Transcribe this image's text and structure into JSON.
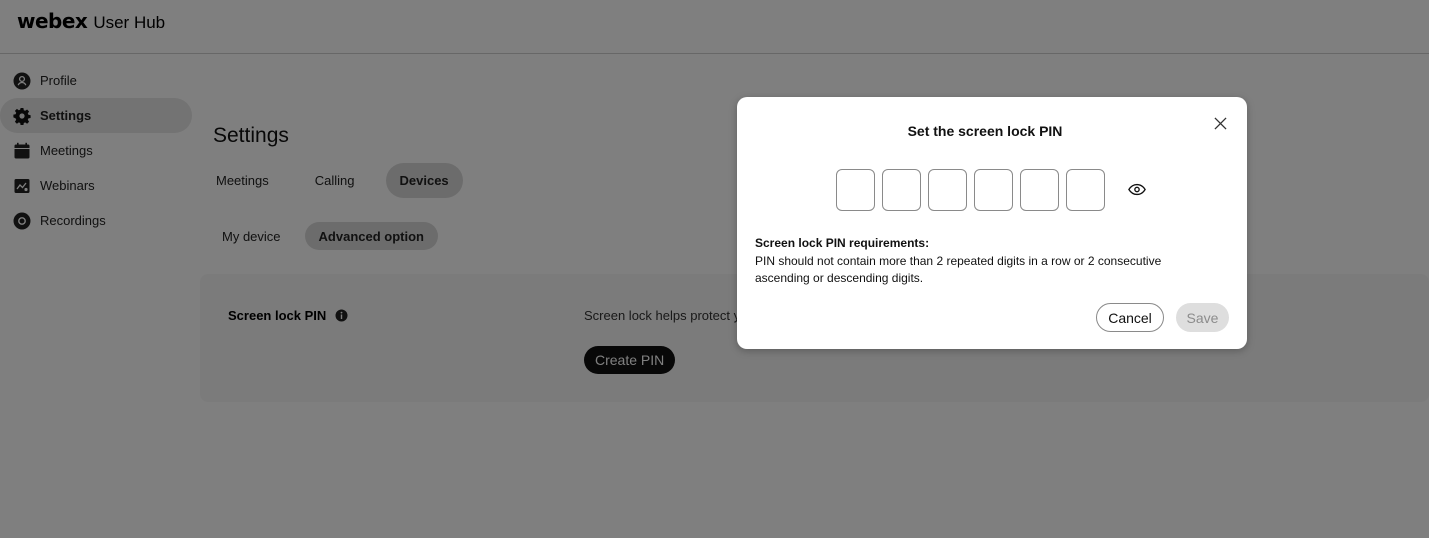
{
  "header": {
    "brand": "webex",
    "product": "User Hub"
  },
  "sidebar": {
    "items": [
      {
        "label": "Profile",
        "icon": "profile-icon"
      },
      {
        "label": "Settings",
        "icon": "gear-icon",
        "active": true
      },
      {
        "label": "Meetings",
        "icon": "calendar-icon"
      },
      {
        "label": "Webinars",
        "icon": "webinar-icon"
      },
      {
        "label": "Recordings",
        "icon": "recording-icon"
      }
    ]
  },
  "main": {
    "title": "Settings",
    "tabs": [
      {
        "label": "Meetings"
      },
      {
        "label": "Calling"
      },
      {
        "label": "Devices",
        "active": true
      }
    ],
    "subtabs": [
      {
        "label": "My device"
      },
      {
        "label": "Advanced option",
        "active": true
      }
    ],
    "card": {
      "label": "Screen lock PIN",
      "description": "Screen lock helps protect y",
      "button": "Create PIN"
    }
  },
  "modal": {
    "title": "Set the screen lock PIN",
    "pin_values": [
      "",
      "",
      "",
      "",
      "",
      ""
    ],
    "requirements_title": "Screen lock PIN requirements:",
    "requirements_text": "PIN should not contain more than 2 repeated digits in a row or 2 consecutive ascending or descending digits.",
    "cancel_label": "Cancel",
    "save_label": "Save",
    "save_enabled": false
  },
  "colors": {
    "overlay": "#7f7f7f",
    "primary_button": "#111111",
    "disabled_button": "#dedede"
  }
}
